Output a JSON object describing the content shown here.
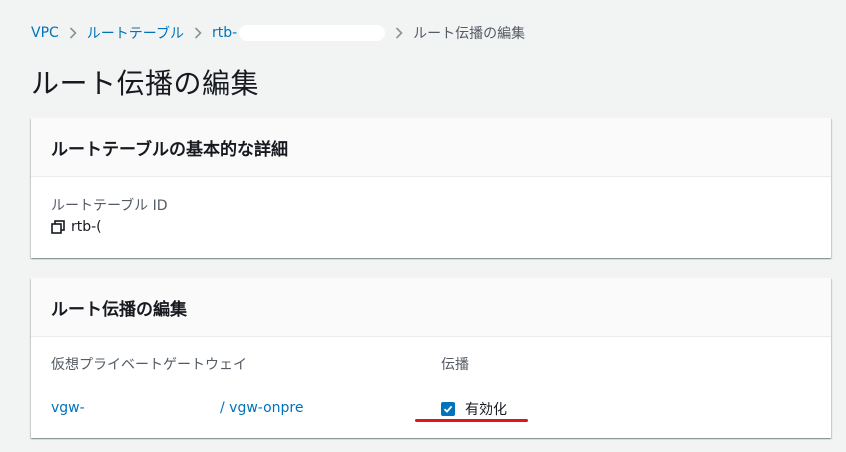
{
  "breadcrumb": {
    "items": [
      "VPC",
      "ルートテーブル",
      "rtb-"
    ],
    "current": "ルート伝播の編集"
  },
  "page": {
    "title": "ルート伝播の編集"
  },
  "details_panel": {
    "title": "ルートテーブルの基本的な詳細",
    "id_label": "ルートテーブル ID",
    "id_value": "rtb-(",
    "copy_icon": "copy-icon"
  },
  "propagation_panel": {
    "title": "ルート伝播の編集",
    "columns": {
      "gateway": "仮想プライベートゲートウェイ",
      "propagation": "伝播"
    },
    "rows": [
      {
        "gateway_id": "vgw-",
        "gateway_name": "/ vgw-onpre",
        "enabled": true,
        "enabled_label": "有効化"
      }
    ]
  },
  "colors": {
    "link": "#0073bb",
    "checkbox": "#0073bb",
    "annotation": "#e0161d"
  }
}
